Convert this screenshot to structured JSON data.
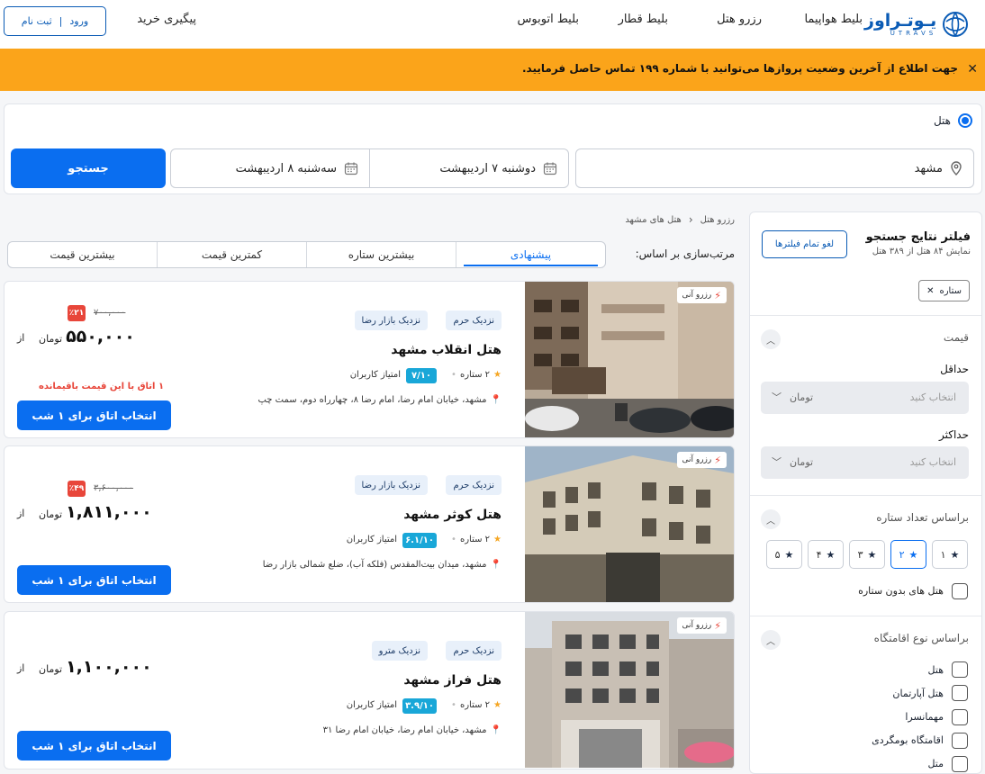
{
  "header": {
    "logo_text": "یـوتـراوز",
    "logo_sub": "UTRAVS",
    "nav": [
      "بلیط هواپیما",
      "رزرو هتل",
      "بلیط قطار",
      "بلیط اتوبوس"
    ],
    "track": "پیگیری خرید",
    "login": "ورود",
    "signup": "ثبت نام"
  },
  "banner": {
    "text": "جهت اطلاع از آخرین وضعیت پروازها می‌توانید با شماره ۱۹۹ تماس حاصل فرمایید."
  },
  "search": {
    "type_label": "هتل",
    "destination": "مشهد",
    "checkin": "دوشنبه ۷ اردیبهشت",
    "checkout": "سه‌شنبه ۸ اردیبهشت",
    "button": "جستجو"
  },
  "breadcrumb": [
    "رزرو هتل",
    "هتل های مشهد"
  ],
  "sort": {
    "label": "مرتب‌سازی بر اساس:",
    "tabs": [
      "پیشنهادی",
      "بیشترین ستاره",
      "کمترین قیمت",
      "بیشترین قیمت"
    ]
  },
  "filters": {
    "title": "فیلتر نتایج جستجو",
    "count": "نمایش ۸۴ هتل از ۳۸۹ هتل",
    "clear_all": "لغو تمام فیلترها",
    "active_chip": "ستاره",
    "price": {
      "title": "قیمت",
      "min_label": "حداقل",
      "max_label": "حداکثر",
      "placeholder": "انتخاب کنید",
      "unit": "تومان"
    },
    "stars": {
      "title": "براساس تعداد ستاره",
      "options": [
        "۱",
        "۲",
        "۳",
        "۴",
        "۵"
      ],
      "no_star": "هتل های بدون ستاره"
    },
    "type": {
      "title": "براساس نوع اقامتگاه",
      "options": [
        "هتل",
        "هتل آپارتمان",
        "مهمانسرا",
        "اقامتگاه بومگردی",
        "متل"
      ]
    }
  },
  "hotels": [
    {
      "name": "هتل انقلاب مشهد",
      "tags": [
        "نزدیک حرم",
        "نزدیک بازار رضا"
      ],
      "stars": "۲ ستاره",
      "rating": "۷/۱۰",
      "rating_label": "امتیاز کاربران",
      "address": "مشهد، خیابان امام رضا، امام رضا ۸، چهارراه دوم، سمت چپ",
      "badge": "رزرو آنی",
      "old_price": "۷۰۰,۰۰۰",
      "discount": "٪۲۱",
      "price": "۵۵۰,۰۰۰",
      "unit": "تومان",
      "from": "از",
      "rooms_left": "۱ اتاق با این قیمت باقیمانده",
      "button": "انتخاب اتاق برای ۱ شب"
    },
    {
      "name": "هتل کوثر مشهد",
      "tags": [
        "نزدیک حرم",
        "نزدیک بازار رضا"
      ],
      "stars": "۲ ستاره",
      "rating": "۶.۱/۱۰",
      "rating_label": "امتیاز کاربران",
      "address": "مشهد، میدان بیت‌المقدس (فلکه آب)، ضلع شمالی بازار رضا",
      "badge": "رزرو آنی",
      "old_price": "۳,۶۰۰,۰۰۰",
      "discount": "٪۴۹",
      "price": "۱,۸۱۱,۰۰۰",
      "unit": "تومان",
      "from": "از",
      "button": "انتخاب اتاق برای ۱ شب"
    },
    {
      "name": "هتل فراز مشهد",
      "tags": [
        "نزدیک حرم",
        "نزدیک مترو"
      ],
      "stars": "۲ ستاره",
      "rating": "۳.۹/۱۰",
      "rating_label": "امتیاز کاربران",
      "address": "مشهد، خیابان امام رضا، خیابان امام رضا ۳۱",
      "badge": "رزرو آنی",
      "price": "۱,۱۰۰,۰۰۰",
      "unit": "تومان",
      "from": "از",
      "button": "انتخاب اتاق برای ۱ شب"
    }
  ]
}
